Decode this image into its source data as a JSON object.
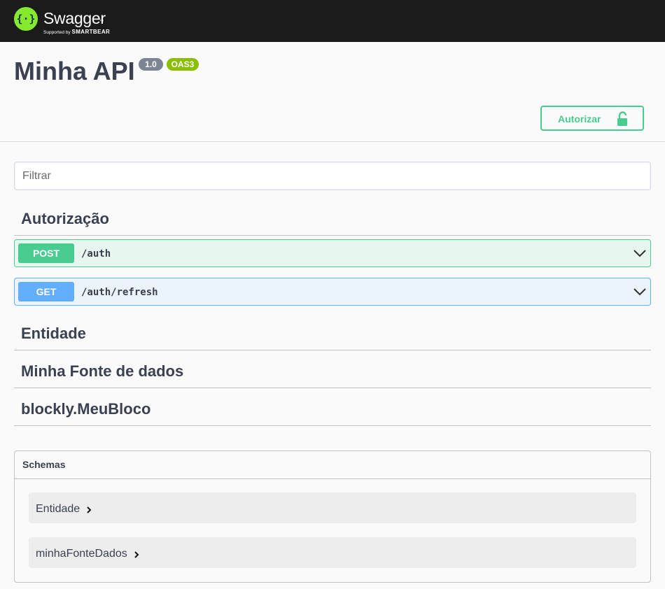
{
  "topbar": {
    "brand": "Swagger",
    "tm": "™",
    "supported_by": "Supported by",
    "company": "SMARTBEAR"
  },
  "info": {
    "title": "Minha API",
    "version": "1.0",
    "oas": "OAS3",
    "authorize_label": "Autorizar"
  },
  "filter": {
    "placeholder": "Filtrar",
    "value": ""
  },
  "tags": [
    {
      "name": "Autorização"
    },
    {
      "name": "Entidade"
    },
    {
      "name": "Minha Fonte de dados"
    },
    {
      "name": "blockly.MeuBloco"
    }
  ],
  "operations": [
    {
      "method": "POST",
      "path": "/auth"
    },
    {
      "method": "GET",
      "path": "/auth/refresh"
    }
  ],
  "schemas": {
    "title": "Schemas",
    "models": [
      {
        "name": "Entidade"
      },
      {
        "name": "minhaFonteDados"
      }
    ]
  },
  "colors": {
    "topbar": "#1b1b1b",
    "logo_green": "#85ea2d",
    "post": "#49cc90",
    "get": "#61affe",
    "version_badge": "#7d8492",
    "oas_badge": "#89bf04"
  }
}
